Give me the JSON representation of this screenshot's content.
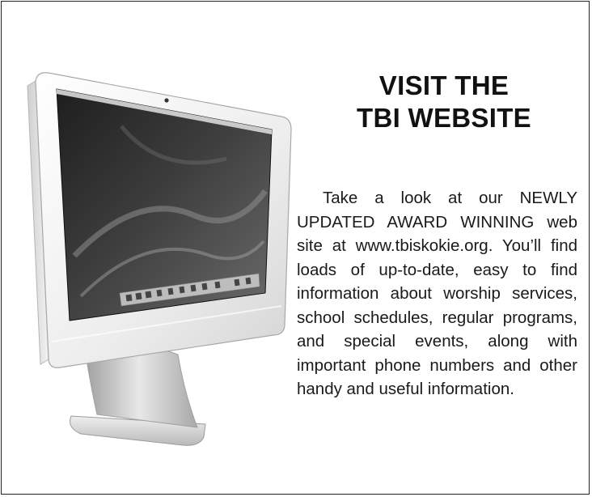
{
  "heading": {
    "line1": "VISIT THE",
    "line2": "TBI WEBSITE"
  },
  "body": "Take a look at our NEWLY UPDATED AWARD WINNING web site at www.tbiskokie.org. You’ll find loads of up-to-date, easy to find information about worship services, school schedules, regular programs, and special events, along with important phone numbers and other handy and useful information.",
  "illustration": {
    "icon": "computer-monitor-icon"
  }
}
